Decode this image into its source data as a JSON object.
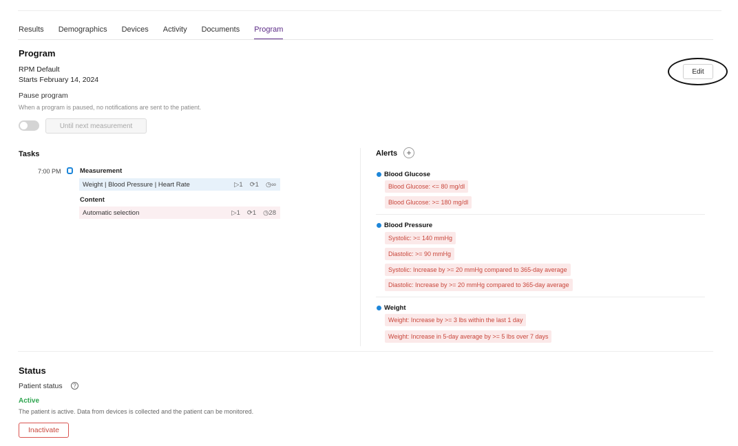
{
  "tabs": [
    "Results",
    "Demographics",
    "Devices",
    "Activity",
    "Documents",
    "Program"
  ],
  "program": {
    "heading": "Program",
    "name": "RPM Default",
    "start": "Starts February 14, 2024",
    "pause_label": "Pause program",
    "pause_help": "When a program is paused, no notifications are sent to the patient.",
    "pause_enabled": false,
    "until_button": "Until next measurement",
    "edit_button": "Edit"
  },
  "tasks": {
    "heading": "Tasks",
    "time": "7:00 PM",
    "measurement": {
      "title": "Measurement",
      "label": "Weight | Blood Pressure | Heart Rate",
      "stats": [
        "▷1",
        "⟳1",
        "◷∞"
      ]
    },
    "content": {
      "title": "Content",
      "label": "Automatic selection",
      "stats": [
        "▷1",
        "⟳1",
        "◷28"
      ]
    }
  },
  "alerts": {
    "heading": "Alerts",
    "add_icon": "+",
    "groups": [
      {
        "title": "Blood Glucose",
        "items": [
          "Blood Glucose: <= 80 mg/dl",
          "Blood Glucose: >= 180 mg/dl"
        ]
      },
      {
        "title": "Blood Pressure",
        "items": [
          "Systolic: >= 140 mmHg",
          "Diastolic: >= 90 mmHg",
          "Systolic: Increase by >= 20 mmHg compared to 365-day average",
          "Diastolic: Increase by >= 20 mmHg compared to 365-day average"
        ]
      },
      {
        "title": "Weight",
        "items": [
          "Weight: Increase by >= 3 lbs within the last 1 day",
          "Weight: Increase in 5-day average by >= 5 lbs over 7 days"
        ]
      }
    ],
    "dot_color": "#1d86d9"
  },
  "status": {
    "heading": "Status",
    "label": "Patient status",
    "help_icon": "?",
    "value": "Active",
    "description": "The patient is active. Data from devices is collected and the patient can be monitored.",
    "inactivate_button": "Inactivate"
  },
  "colors": {
    "accent": "#5b2a86",
    "alert_text": "#c8463b",
    "alert_bg": "#fbe9e9",
    "active": "#2ea44f"
  }
}
